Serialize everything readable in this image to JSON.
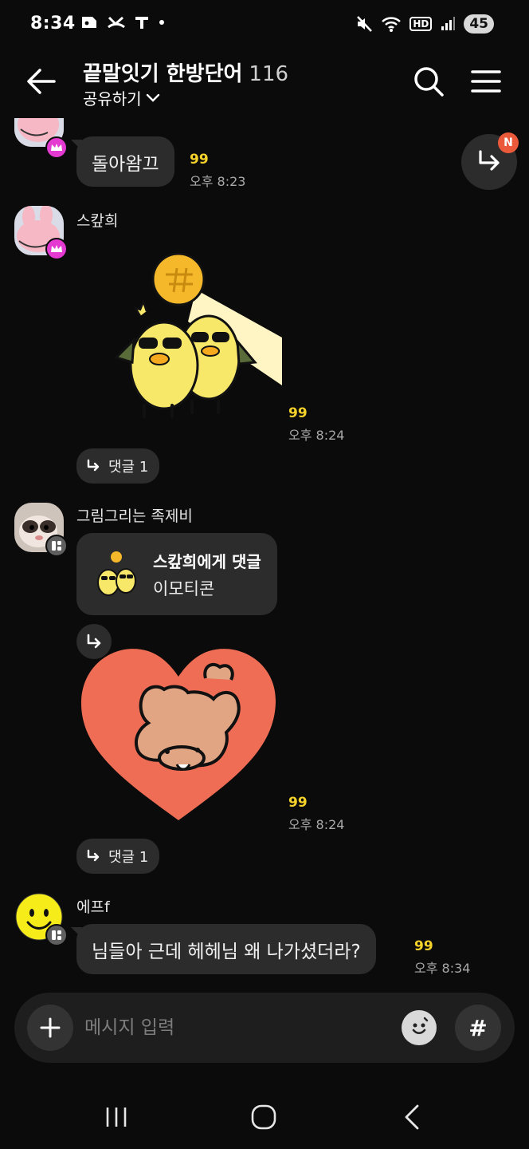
{
  "status": {
    "time": "8:34",
    "battery": "45",
    "network_badge": "HD"
  },
  "header": {
    "title": "끝말잇기 한방단어",
    "member_count": "116",
    "share_label": "공유하기"
  },
  "float_reply": {
    "badge": "N"
  },
  "messages": [
    {
      "sender": "",
      "text": "돌아왐끄",
      "unread": "99",
      "time": "오후 8:23"
    },
    {
      "sender": "스캎희",
      "sticker": "duck-pair-sticker",
      "unread": "99",
      "time": "오후 8:24",
      "reply_label": "댓글 1"
    },
    {
      "sender": "그림그리는 족제비",
      "reply_card_title": "스캎희에게 댓글",
      "reply_card_sub": "이모티콘",
      "sticker": "heart-bear-sticker",
      "unread": "99",
      "time": "오후 8:24",
      "reply_label": "댓글 1"
    },
    {
      "sender": "에프f",
      "text": "님들아 근데 헤헤님 왜 나가셨더라?",
      "unread": "99",
      "time": "오후 8:34"
    }
  ],
  "composer": {
    "placeholder": "메시지 입력",
    "hash_label": "#"
  },
  "colors": {
    "background": "#0b0b0b",
    "bubble": "#2c2c2c",
    "unread": "#f6d32a",
    "crown_badge": "#e43ad1",
    "new_badge": "#ea5a3a"
  }
}
